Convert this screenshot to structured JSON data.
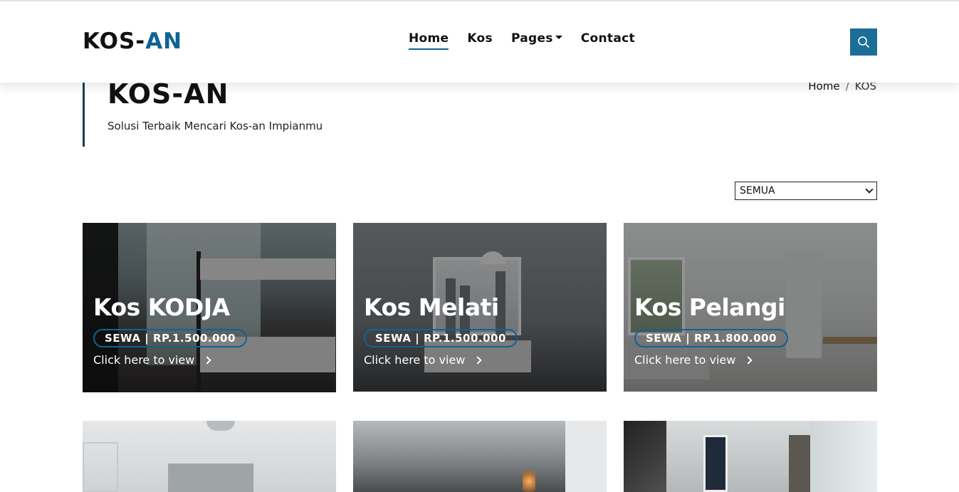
{
  "brand": {
    "logo_part1": "KOS-",
    "logo_part2": "AN",
    "accent_color": "#0e6394"
  },
  "nav": {
    "items": [
      {
        "label": "Home",
        "active": true
      },
      {
        "label": "Kos",
        "active": false
      },
      {
        "label": "Pages",
        "active": false,
        "dropdown": true
      },
      {
        "label": "Contact",
        "active": false
      }
    ],
    "search_icon": "search-icon"
  },
  "hero": {
    "title": "KOS-AN",
    "subtitle": "Solusi Terbaik Mencari Kos-an Impianmu"
  },
  "breadcrumb": {
    "home": "Home",
    "separator": "/",
    "current": "KOS"
  },
  "filter": {
    "selected": "SEMUA"
  },
  "listings": [
    {
      "name": "Kos KODJA",
      "price": "SEWA | RP.1.500.000",
      "cta": "Click here to view"
    },
    {
      "name": "Kos Melati",
      "price": "SEWA | RP.1.500.000",
      "cta": "Click here to view"
    },
    {
      "name": "Kos Pelangi",
      "price": "SEWA | RP.1.800.000",
      "cta": "Click here to view"
    }
  ]
}
